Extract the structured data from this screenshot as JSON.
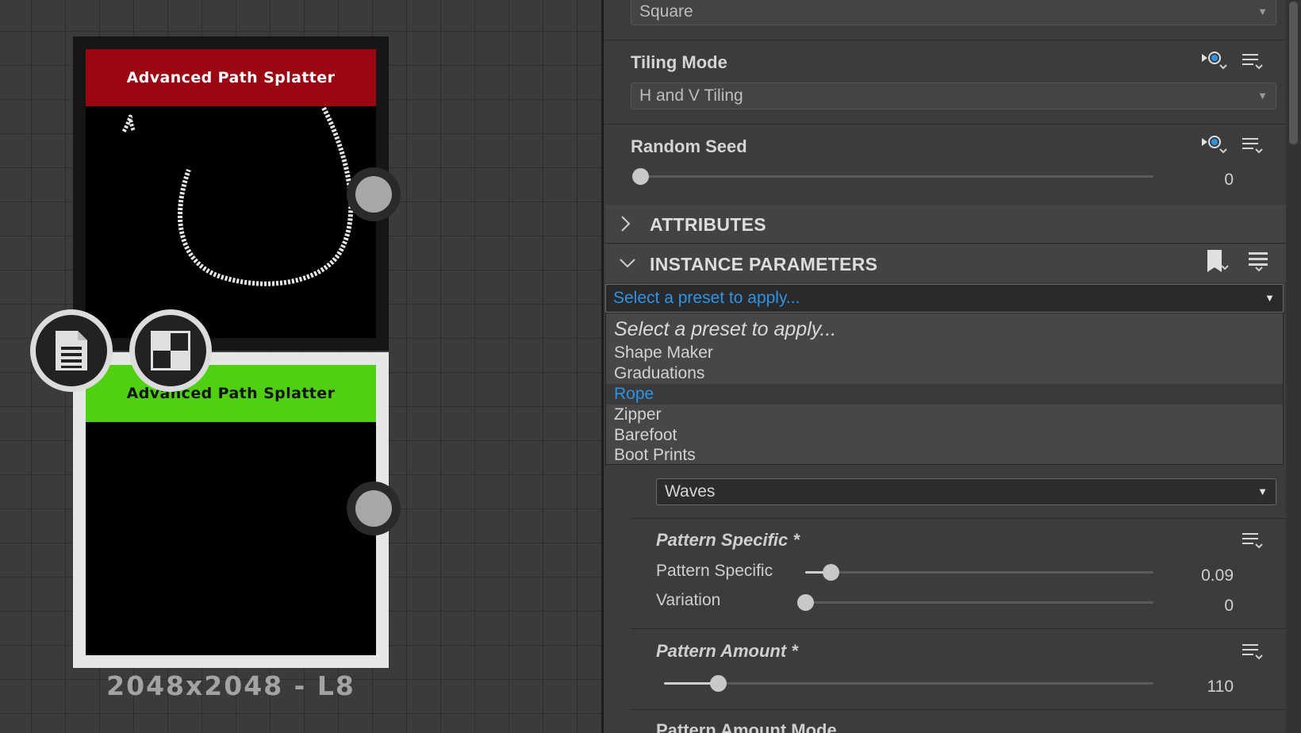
{
  "graph": {
    "nodes": [
      {
        "title": "Advanced Path Splatter",
        "color": "#9c0610"
      },
      {
        "title": "Advanced Path Splatter",
        "color": "#4fd10f"
      }
    ],
    "resolution_label": "2048x2048 - L8",
    "badges": [
      "document-icon",
      "checker-icon"
    ]
  },
  "panel": {
    "top_combo": {
      "value": "Square"
    },
    "tiling_mode": {
      "title": "Tiling Mode",
      "value": "H and V Tiling"
    },
    "random_seed": {
      "title": "Random Seed",
      "value": "0",
      "level": 0
    },
    "sections": {
      "attributes": "ATTRIBUTES",
      "instance_parameters": "INSTANCE PARAMETERS"
    },
    "preset": {
      "placeholder": "Select a preset to apply...",
      "options": [
        {
          "label": "Select a preset to apply...",
          "placeholder": true
        },
        {
          "label": "Shape Maker"
        },
        {
          "label": "Graduations"
        },
        {
          "label": "Rope",
          "selected": true
        },
        {
          "label": "Zipper"
        },
        {
          "label": "Barefoot"
        },
        {
          "label": "Boot Prints"
        }
      ]
    },
    "pattern_combo": {
      "value": "Waves"
    },
    "pattern_specific": {
      "title": "Pattern Specific *",
      "params": [
        {
          "label": "Pattern Specific",
          "value": "0.09",
          "level": 0.09
        },
        {
          "label": "Variation",
          "value": "0",
          "level": 0
        }
      ]
    },
    "pattern_amount": {
      "title": "Pattern Amount *",
      "value": "110",
      "level": 0.11
    },
    "pattern_amount_mode": {
      "title": "Pattern Amount Mode"
    }
  },
  "colors": {
    "accent": "#2a95e8",
    "panel_bg": "#3c3c3c",
    "canvas_bg": "#3b3b3b"
  }
}
